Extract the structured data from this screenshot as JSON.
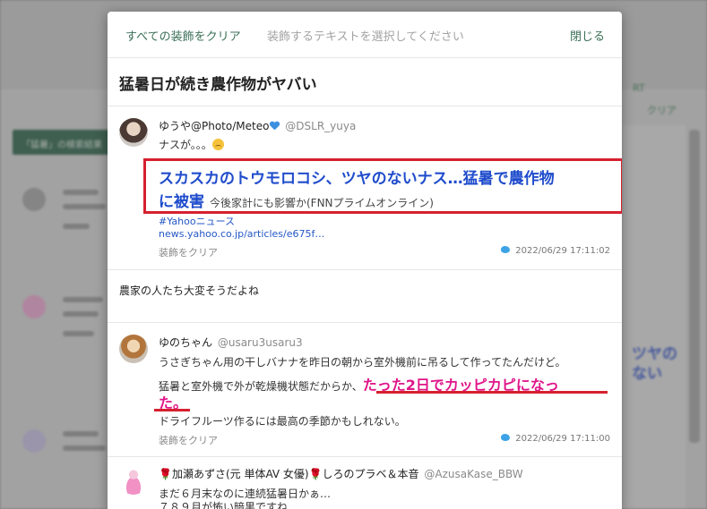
{
  "background": {
    "clear_label": "クリア",
    "bar_label": "「猛暑」の検索結果",
    "blurred_headline": "ツヤの\nない..."
  },
  "header": {
    "clear_all": "すべての装飾をクリア",
    "hint": "装飾するテキストを選択してください",
    "close": "閉じる"
  },
  "title": "猛暑日が続き農作物がヤバい",
  "items": [
    {
      "name": "ゆうや@Photo/Meteo",
      "handle": "@DSLR_yuya",
      "text": "ナスが。。。",
      "headline": "スカスカのトウモロコシ、ツヤのないナス…猛暑で農作物",
      "headline2": "に被害",
      "headline_sub": "今後家計にも影響か(FNNプライムオンライン)",
      "hashtag": "#Yahooニュース",
      "url": "news.yahoo.co.jp/articles/e675f…",
      "clear": "装飾をクリア",
      "time": "2022/06/29 17:11:02"
    },
    {
      "text": "農家の人たち大変そうだよね"
    },
    {
      "name": "ゆのちゃん",
      "handle": "@usaru3usaru3",
      "line1": "うさぎちゃん用の干しバナナを昨日の朝から室外機前に吊るして作ってたんだけど。",
      "line2a": "猛暑と室外機で外が乾燥機状態だからか、",
      "line2b": "たった2日でカッピカピになっ",
      "line3a": "た。",
      "line4": "ドライフルーツ作るには最高の季節かもしれない。",
      "clear": "装飾をクリア",
      "time": "2022/06/29 17:11:00"
    },
    {
      "name": "🌹加瀬あずさ(元 単体AV 女優)🌹しろのプラベ＆本音",
      "handle": "@AzusaKase_BBW",
      "line1": "まだ６月末なのに連続猛暑日かぁ…",
      "line2": "７８９月が怖い暗黒ですね"
    }
  ]
}
